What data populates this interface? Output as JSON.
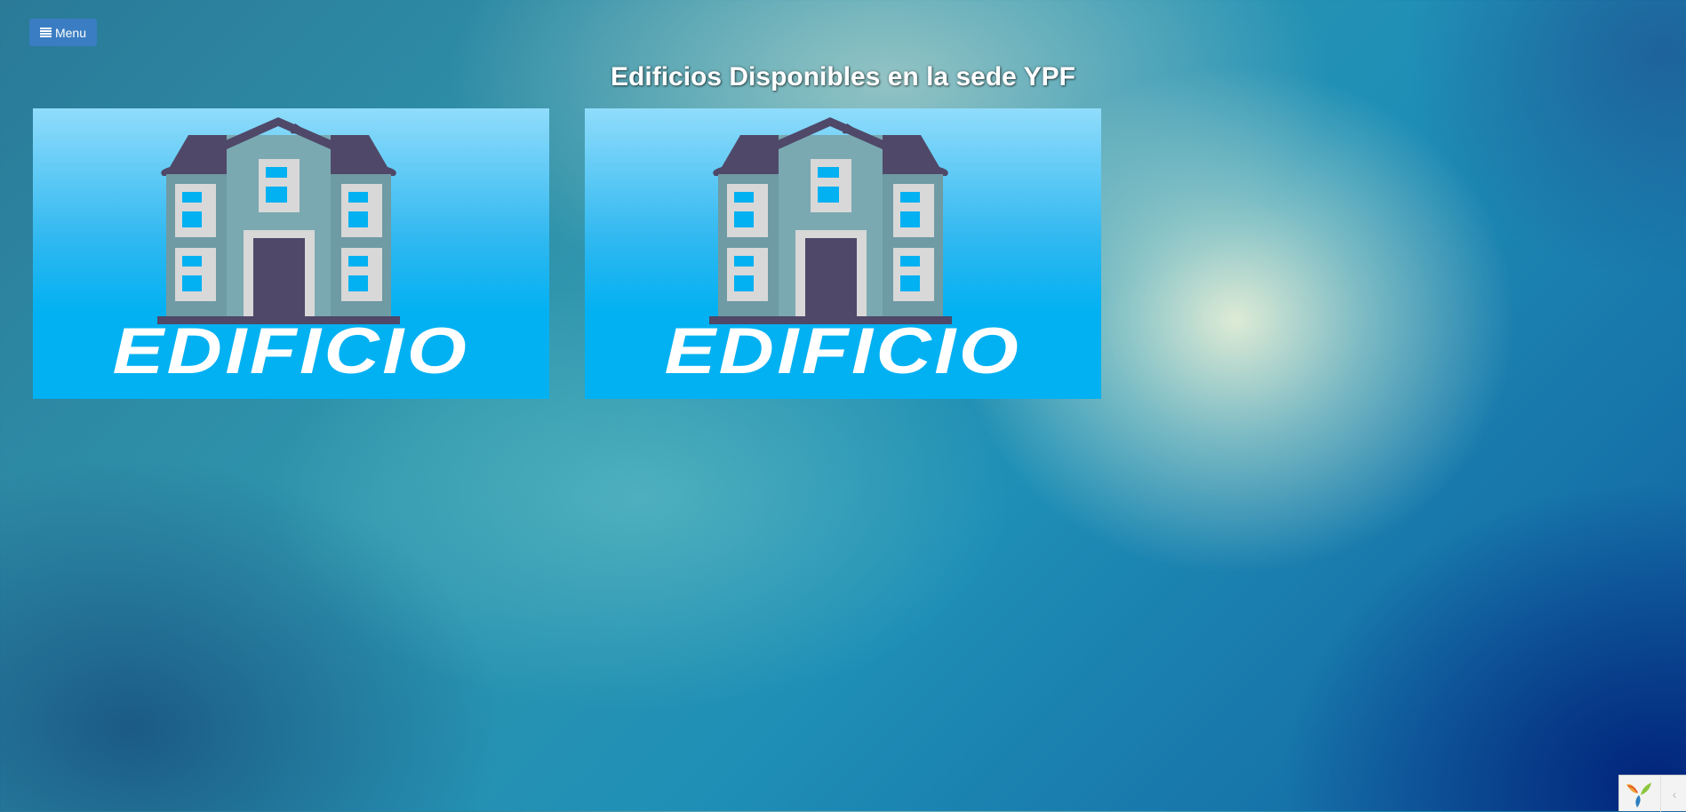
{
  "menu": {
    "label": "Menu",
    "icon": "list-icon"
  },
  "title": "Edificios Disponibles en la sede YPF",
  "buildings": [
    {
      "label": "EDIFICIO",
      "icon": "building-icon"
    },
    {
      "label": "EDIFICIO",
      "icon": "building-icon"
    }
  ],
  "debug_toolbar": {
    "logo": "yii-logo-icon",
    "toggle_glyph": "‹"
  },
  "colors": {
    "menu_button": "#3a7dc2",
    "card_blue": "#02b1f2",
    "roof": "#4f4868",
    "wall": "#6e9ba4",
    "window": "#02b1f2",
    "frame": "#d8d8d8"
  }
}
